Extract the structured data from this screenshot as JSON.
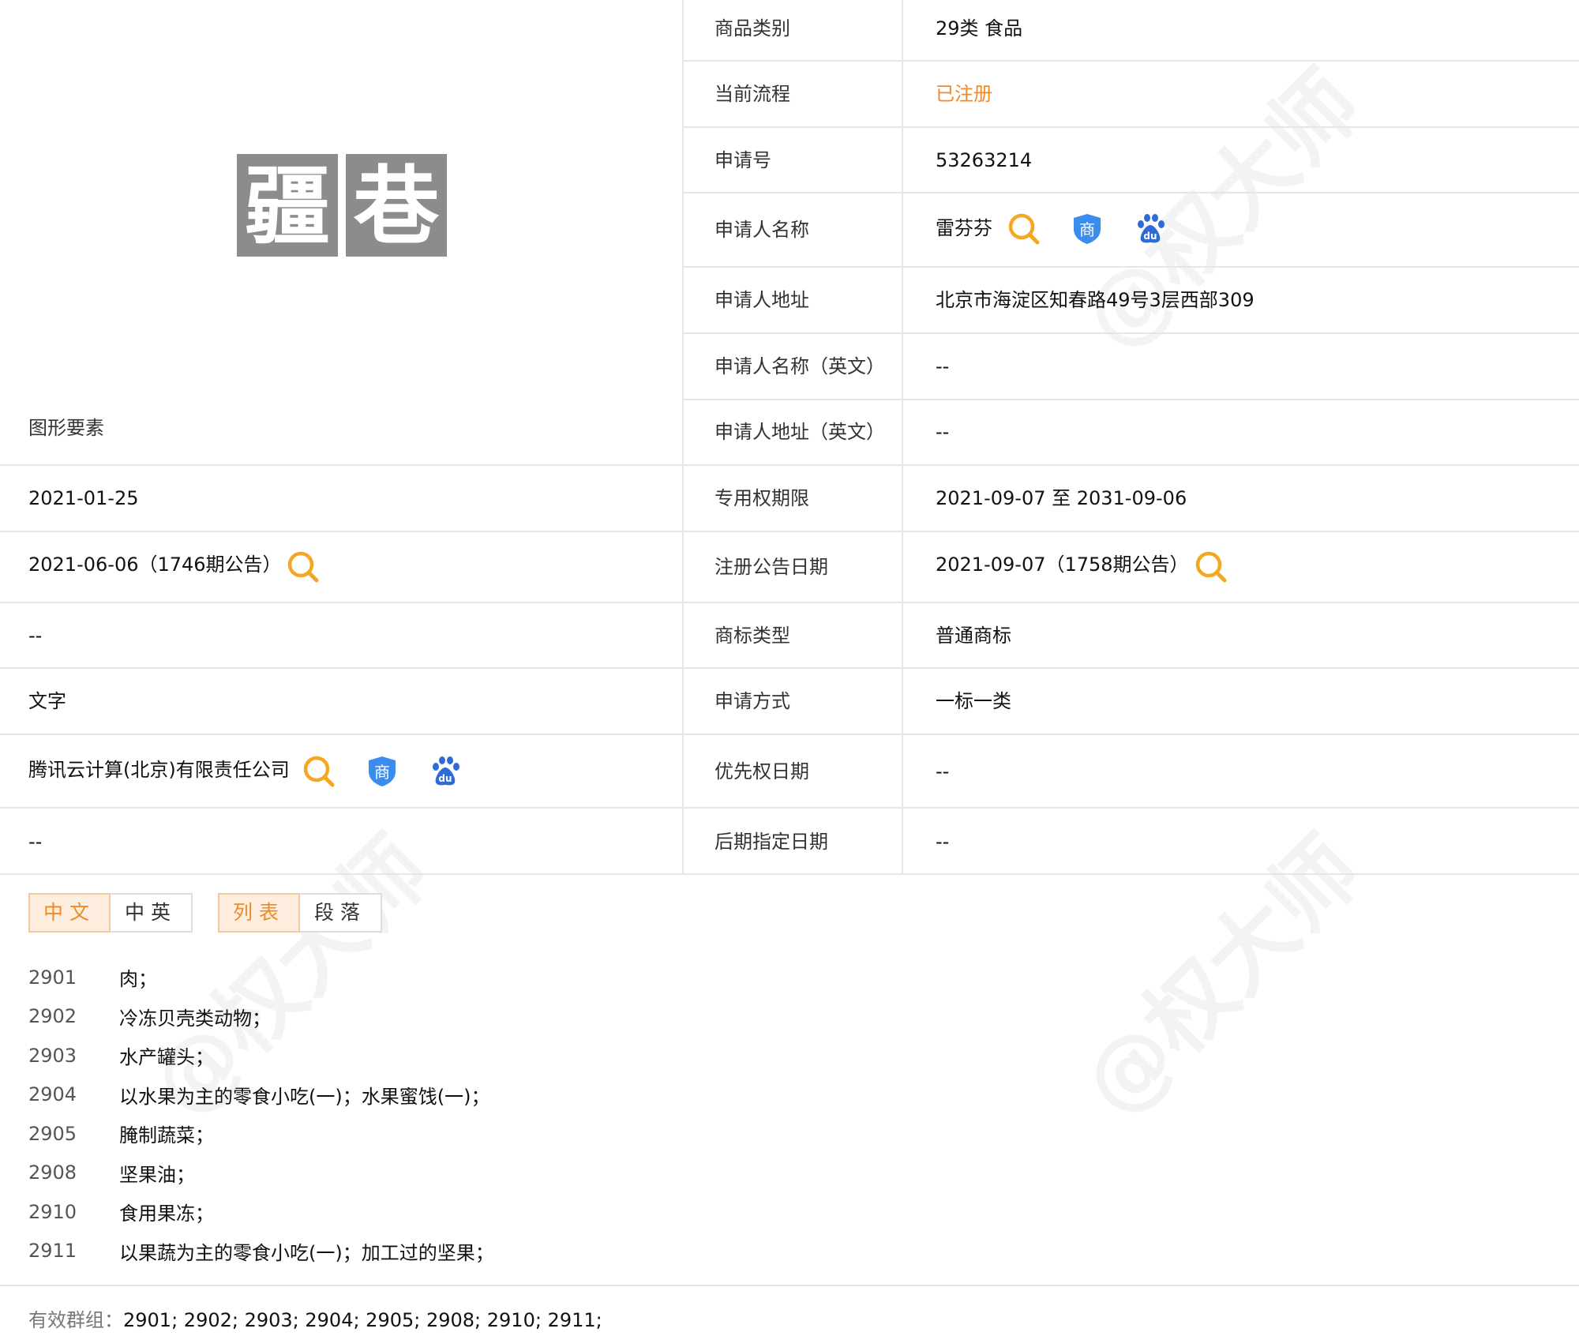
{
  "left": {
    "figure_label": "图形要素",
    "rows": [
      {
        "value": "2021-01-25"
      },
      {
        "value": "2021-06-06（1746期公告）"
      },
      {
        "value": "--"
      },
      {
        "value": "文字"
      },
      {
        "value": "腾讯云计算(北京)有限责任公司"
      },
      {
        "value": "--"
      }
    ]
  },
  "logo_text": "疆巷",
  "right": {
    "rows": [
      {
        "label": "商品类别",
        "value": "29类 食品"
      },
      {
        "label": "当前流程",
        "value": "已注册"
      },
      {
        "label": "申请号",
        "value": "53263214"
      },
      {
        "label": "申请人名称",
        "value": "雷芬芬"
      },
      {
        "label": "申请人地址",
        "value": "北京市海淀区知春路49号3层西部309"
      },
      {
        "label": "申请人名称（英文）",
        "value": "--"
      },
      {
        "label": "申请人地址（英文）",
        "value": "--"
      },
      {
        "label": "专用权期限",
        "value": "2021-09-07 至 2031-09-06"
      },
      {
        "label": "注册公告日期",
        "value": "2021-09-07（1758期公告）"
      },
      {
        "label": "商标类型",
        "value": "普通商标"
      },
      {
        "label": "申请方式",
        "value": "一标一类"
      },
      {
        "label": "优先权日期",
        "value": "--"
      },
      {
        "label": "后期指定日期",
        "value": "--"
      }
    ]
  },
  "tabs": {
    "lang": [
      "中文",
      "中英"
    ],
    "mode": [
      "列表",
      "段落"
    ]
  },
  "goods": [
    {
      "code": "2901",
      "text": "肉；"
    },
    {
      "code": "2902",
      "text": "冷冻贝壳类动物；"
    },
    {
      "code": "2903",
      "text": "水产罐头；"
    },
    {
      "code": "2904",
      "text": "以水果为主的零食小吃(一)；水果蜜饯(一)；"
    },
    {
      "code": "2905",
      "text": "腌制蔬菜；"
    },
    {
      "code": "2908",
      "text": "坚果油；"
    },
    {
      "code": "2910",
      "text": "食用果冻；"
    },
    {
      "code": "2911",
      "text": "以果蔬为主的零食小吃(一)；加工过的坚果；"
    }
  ],
  "groups": {
    "label": "有效群组：",
    "values": "2901;   2902;   2903;   2904;   2905;   2908;   2910;   2911;"
  },
  "watermark": "@权大师",
  "colors": {
    "accent": "#f08a24",
    "search": "#f5a623",
    "shield": "#3b8ded",
    "baidu": "#2f6bd8"
  }
}
